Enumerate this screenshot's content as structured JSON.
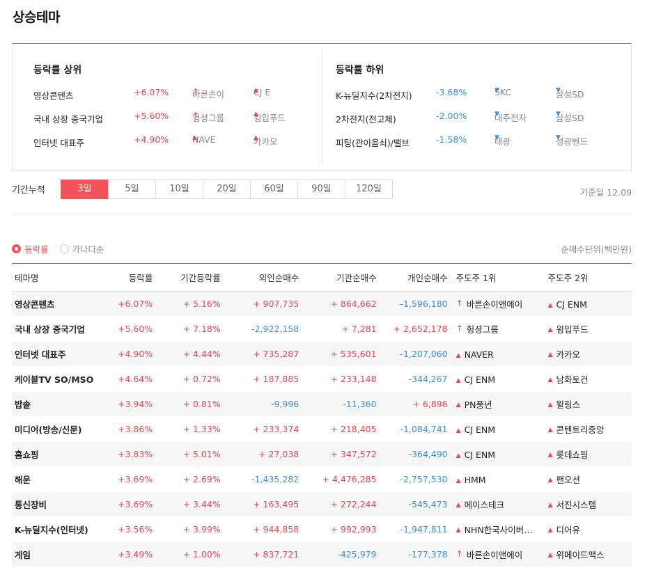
{
  "page": {
    "title": "상승테마"
  },
  "summary": {
    "top": {
      "title": "등락률 상위",
      "rows": [
        {
          "name": "영상콘텐츠",
          "rate": "+6.07%",
          "s1": "바른손이",
          "s1_mark": "↑",
          "s2": "CJ E",
          "s2_mark": "▲"
        },
        {
          "name": "국내 상장 중국기업",
          "rate": "+5.60%",
          "s1": "헝셩그룹",
          "s1_mark": "↑",
          "s2": "윙입푸드",
          "s2_mark": "▲"
        },
        {
          "name": "인터넷 대표주",
          "rate": "+4.90%",
          "s1": "NAVE",
          "s1_mark": "▲",
          "s2": "카카오",
          "s2_mark": "▲"
        }
      ]
    },
    "bottom": {
      "title": "등락률 하위",
      "rows": [
        {
          "name": "K-뉴딜지수(2차전지)",
          "rate": "-3.68%",
          "s1": "SKC",
          "s1_mark": "▼",
          "s2": "삼성SD",
          "s2_mark": "▼"
        },
        {
          "name": "2차전지(전고체)",
          "rate": "-2.00%",
          "s1": "대주전자",
          "s1_mark": "▼",
          "s2": "삼성SD",
          "s2_mark": "▼"
        },
        {
          "name": "피팅(관이음쇠)/밸브",
          "rate": "-1.58%",
          "s1": "태광",
          "s1_mark": "▼",
          "s2": "성광벤드",
          "s2_mark": "▼"
        }
      ]
    }
  },
  "period": {
    "label": "기간누적",
    "tabs": [
      "3일",
      "5일",
      "10일",
      "20일",
      "60일",
      "90일",
      "120일"
    ],
    "active": 0,
    "base_date": "기준일 12.09"
  },
  "sort": {
    "options": [
      "등락률",
      "가나다순"
    ],
    "selected": 0,
    "unit": "순매수단위(백만원)"
  },
  "table": {
    "headers": [
      "테마명",
      "등락률",
      "기간등락률",
      "외인순매수",
      "기관순매수",
      "개인순매수",
      "주도주 1위",
      "주도주 2위"
    ],
    "rows": [
      {
        "name": "영상콘텐츠",
        "rate": "+6.07%",
        "prate": "+ 5.16%",
        "foreign": "+ 907,735",
        "inst": "+ 864,662",
        "indiv": "-1,596,180",
        "s1": "바른손이앤에이",
        "s1_mark": "↑",
        "s2": "CJ ENM",
        "s2_mark": "▲"
      },
      {
        "name": "국내 상장 중국기업",
        "rate": "+5.60%",
        "prate": "+ 7.18%",
        "foreign": "-2,922,158",
        "inst": "+ 7,281",
        "indiv": "+ 2,652,178",
        "s1": "헝셩그룹",
        "s1_mark": "↑",
        "s2": "윙입푸드",
        "s2_mark": "▲"
      },
      {
        "name": "인터넷 대표주",
        "rate": "+4.90%",
        "prate": "+ 4.44%",
        "foreign": "+ 735,287",
        "inst": "+ 535,601",
        "indiv": "-1,207,060",
        "s1": "NAVER",
        "s1_mark": "▲",
        "s2": "카카오",
        "s2_mark": "▲"
      },
      {
        "name": "케이블TV SO/MSO",
        "rate": "+4.64%",
        "prate": "+ 0.72%",
        "foreign": "+ 187,885",
        "inst": "+ 233,148",
        "indiv": "-344,267",
        "s1": "CJ ENM",
        "s1_mark": "▲",
        "s2": "남화토건",
        "s2_mark": "▲"
      },
      {
        "name": "밥솥",
        "rate": "+3.94%",
        "prate": "+ 0.81%",
        "foreign": "-9,996",
        "inst": "-11,360",
        "indiv": "+ 6,896",
        "s1": "PN풍년",
        "s1_mark": "▲",
        "s2": "윌링스",
        "s2_mark": "▲"
      },
      {
        "name": "미디어(방송/신문)",
        "rate": "+3.86%",
        "prate": "+ 1.33%",
        "foreign": "+ 233,374",
        "inst": "+ 218,405",
        "indiv": "-1,084,741",
        "s1": "CJ ENM",
        "s1_mark": "▲",
        "s2": "콘텐트리중앙",
        "s2_mark": "▲"
      },
      {
        "name": "홈쇼핑",
        "rate": "+3.83%",
        "prate": "+ 5.01%",
        "foreign": "+ 27,038",
        "inst": "+ 347,572",
        "indiv": "-364,490",
        "s1": "CJ ENM",
        "s1_mark": "▲",
        "s2": "롯데쇼핑",
        "s2_mark": "▲"
      },
      {
        "name": "해운",
        "rate": "+3.69%",
        "prate": "+ 2.69%",
        "foreign": "-1,435,282",
        "inst": "+ 4,476,285",
        "indiv": "-2,757,530",
        "s1": "HMM",
        "s1_mark": "▲",
        "s2": "팬오션",
        "s2_mark": "▲"
      },
      {
        "name": "통신장비",
        "rate": "+3.69%",
        "prate": "+ 3.44%",
        "foreign": "+ 163,495",
        "inst": "+ 272,244",
        "indiv": "-545,473",
        "s1": "에이스테크",
        "s1_mark": "▲",
        "s2": "서진시스템",
        "s2_mark": "▲"
      },
      {
        "name": "K-뉴딜지수(인터넷)",
        "rate": "+3.56%",
        "prate": "+ 3.99%",
        "foreign": "+ 944,858",
        "inst": "+ 992,993",
        "indiv": "-1,947,811",
        "s1": "NHN한국사이버결제",
        "s1_mark": "▲",
        "s2": "디어유",
        "s2_mark": "▲"
      },
      {
        "name": "게임",
        "rate": "+3.49%",
        "prate": "+ 1.00%",
        "foreign": "+ 837,721",
        "inst": "-425,979",
        "indiv": "-177,378",
        "s1": "바른손이앤에이",
        "s1_mark": "↑",
        "s2": "위메이드맥스",
        "s2_mark": "▲"
      }
    ]
  },
  "colors": {
    "up": "#f0444f",
    "down": "#3a8fe0",
    "accent": "#f45459"
  }
}
